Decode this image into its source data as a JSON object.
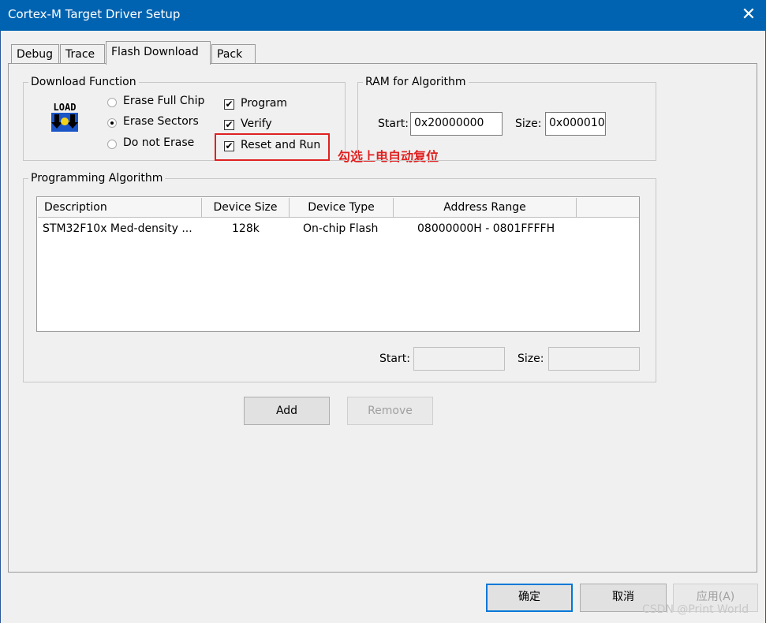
{
  "window": {
    "title": "Cortex-M Target Driver Setup",
    "close_glyph": "✕"
  },
  "tabs": [
    {
      "label": "Debug"
    },
    {
      "label": "Trace"
    },
    {
      "label": "Flash Download"
    },
    {
      "label": "Pack"
    }
  ],
  "download_function": {
    "legend": "Download Function",
    "load_icon_text": "LOAD",
    "erase_options": [
      {
        "label": "Erase Full Chip",
        "selected": false
      },
      {
        "label": "Erase Sectors",
        "selected": true
      },
      {
        "label": "Do not Erase",
        "selected": false
      }
    ],
    "checkboxes": [
      {
        "label": "Program",
        "checked": true
      },
      {
        "label": "Verify",
        "checked": true
      },
      {
        "label": "Reset and Run",
        "checked": true
      }
    ],
    "check_glyph": "✔"
  },
  "annotation": {
    "text": "勾选上电自动复位",
    "color": "#e02020"
  },
  "ram": {
    "legend": "RAM for Algorithm",
    "start_label": "Start:",
    "start_value": "0x20000000",
    "size_label": "Size:",
    "size_value": "0x000010"
  },
  "programming_algorithm": {
    "legend": "Programming Algorithm",
    "columns": [
      "Description",
      "Device Size",
      "Device Type",
      "Address Range"
    ],
    "rows": [
      [
        "STM32F10x Med-density ...",
        "128k",
        "On-chip Flash",
        "08000000H - 0801FFFFH"
      ]
    ],
    "start_label": "Start:",
    "start_value": "",
    "size_label": "Size:",
    "size_value": ""
  },
  "buttons": {
    "add": "Add",
    "remove": "Remove",
    "ok": "确定",
    "cancel": "取消",
    "apply": "应用(A)"
  },
  "watermark": "CSDN @Print World",
  "colors": {
    "titlebar": "#0063b1",
    "accent": "#0078d7",
    "annotation_red": "#e02020"
  }
}
